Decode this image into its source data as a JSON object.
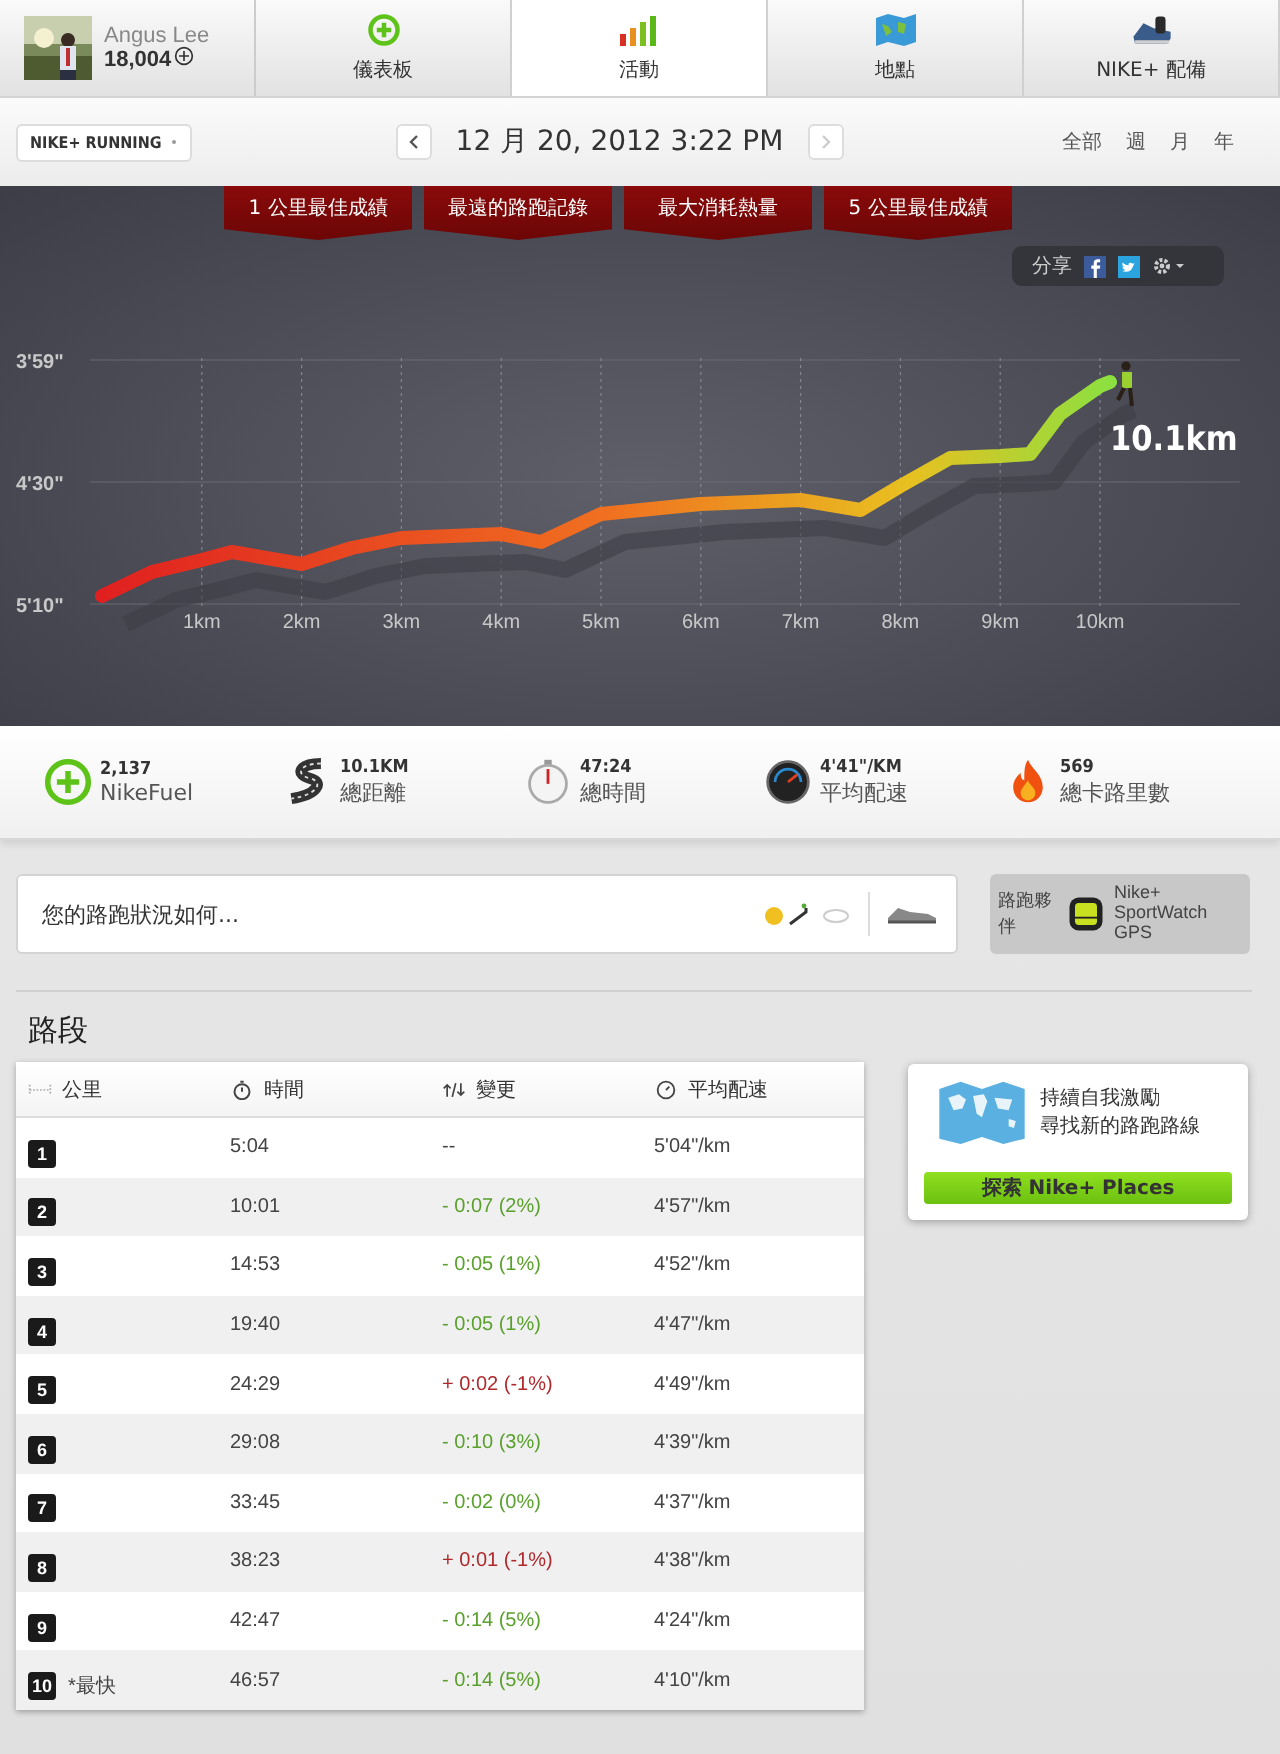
{
  "user": {
    "name": "Angus Lee",
    "fuel": "18,004"
  },
  "tabs": [
    {
      "label": "儀表板",
      "selected": false
    },
    {
      "label": "活動",
      "selected": true
    },
    {
      "label": "地點",
      "selected": false
    },
    {
      "label": "NIKE+ 配備",
      "selected": false
    }
  ],
  "toolbar": {
    "activity": "NIKE+ RUNNING",
    "date": "12 月 20, 2012 3:22 PM",
    "prev_disabled": false,
    "next_disabled": true,
    "ranges": [
      {
        "label": "全部",
        "selected": false
      },
      {
        "label": "週",
        "selected": false
      },
      {
        "label": "月",
        "selected": false
      },
      {
        "label": "年",
        "selected": false
      }
    ]
  },
  "ribbons": [
    "1 公里最佳成績",
    "最遠的路跑記錄",
    "最大消耗熱量",
    "5 公里最佳成績"
  ],
  "share": {
    "label": "分享"
  },
  "run_chart": {
    "distance_label": "10.1km",
    "y_labels": [
      "3'59\"",
      "4'30\"",
      "5'10\""
    ],
    "x_labels": [
      "1km",
      "2km",
      "3km",
      "4km",
      "5km",
      "6km",
      "7km",
      "8km",
      "9km",
      "10km"
    ]
  },
  "stats": [
    {
      "kind": "fuel",
      "value": "2,137",
      "label": "NikeFuel"
    },
    {
      "kind": "distance",
      "value": "10.1KM",
      "label": "總距離"
    },
    {
      "kind": "time",
      "value": "47:24",
      "label": "總時間"
    },
    {
      "kind": "pace",
      "value": "4'41\"/KM",
      "label": "平均配速"
    },
    {
      "kind": "calories",
      "value": "569",
      "label": "總卡路里數"
    }
  ],
  "feedback": {
    "placeholder": "您的路跑狀況如何..."
  },
  "partner": {
    "label": "路跑夥伴",
    "device": "Nike+ SportWatch GPS"
  },
  "splits": {
    "title": "路段",
    "columns": [
      "公里",
      "時間",
      "變更",
      "平均配速"
    ],
    "rows": [
      {
        "km": "1",
        "time": "5:04",
        "change": "--",
        "color": "#444444",
        "pace": "5'04\"/km"
      },
      {
        "km": "2",
        "time": "10:01",
        "change": "- 0:07 (2%)",
        "color": "#5aa02c",
        "pace": "4'57\"/km"
      },
      {
        "km": "3",
        "time": "14:53",
        "change": "- 0:05 (1%)",
        "color": "#5aa02c",
        "pace": "4'52\"/km"
      },
      {
        "km": "4",
        "time": "19:40",
        "change": "- 0:05 (1%)",
        "color": "#5aa02c",
        "pace": "4'47\"/km"
      },
      {
        "km": "5",
        "time": "24:29",
        "change": "+ 0:02 (-1%)",
        "color": "#b0282c",
        "pace": "4'49\"/km"
      },
      {
        "km": "6",
        "time": "29:08",
        "change": "- 0:10 (3%)",
        "color": "#5aa02c",
        "pace": "4'39\"/km"
      },
      {
        "km": "7",
        "time": "33:45",
        "change": "- 0:02 (0%)",
        "color": "#5aa02c",
        "pace": "4'37\"/km"
      },
      {
        "km": "8",
        "time": "38:23",
        "change": "+ 0:01 (-1%)",
        "color": "#b0282c",
        "pace": "4'38\"/km"
      },
      {
        "km": "9",
        "time": "42:47",
        "change": "- 0:14 (5%)",
        "color": "#5aa02c",
        "pace": "4'24\"/km"
      },
      {
        "km": "10",
        "note": "*最快",
        "time": "46:57",
        "change": "- 0:14 (5%)",
        "color": "#5aa02c",
        "pace": "4'10\"/km"
      }
    ]
  },
  "places": {
    "lines": [
      "持續自我激勵",
      "尋找新的路跑路線"
    ],
    "button": "探索 Nike+ Places"
  }
}
